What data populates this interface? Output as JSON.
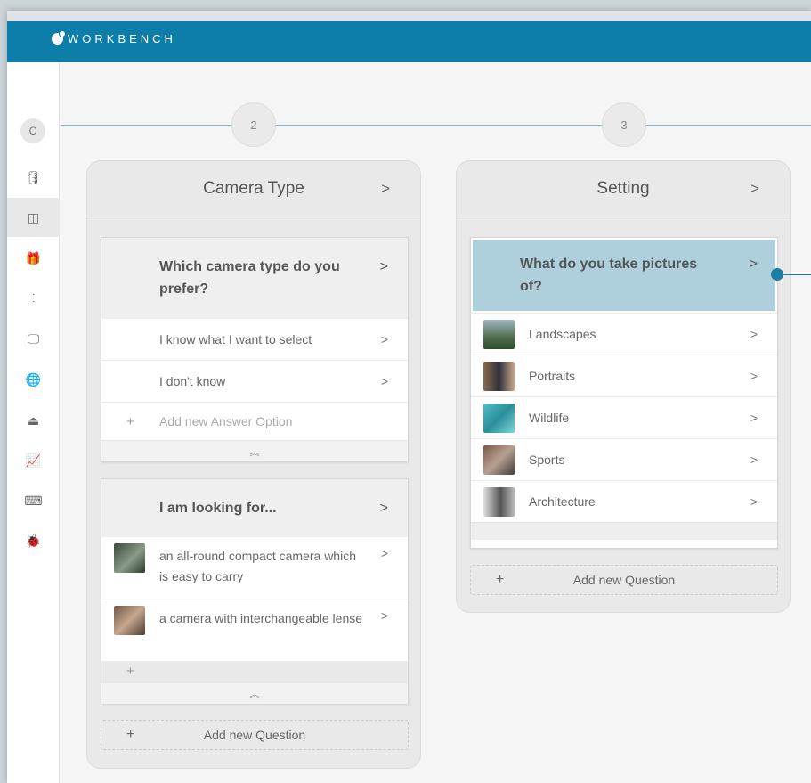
{
  "app": {
    "brand": "WORKBENCH"
  },
  "sidebar": {
    "avatar_letter": "C",
    "items": [
      {
        "icon": "database-icon",
        "glyph": "🛢"
      },
      {
        "icon": "layout-icon",
        "glyph": "◫"
      },
      {
        "icon": "gift-icon",
        "glyph": "🎁"
      },
      {
        "icon": "sliders-icon",
        "glyph": "⫶"
      },
      {
        "icon": "monitor-icon",
        "glyph": "🖵"
      },
      {
        "icon": "globe-icon",
        "glyph": "🌐"
      },
      {
        "icon": "upload-icon",
        "glyph": "⏏"
      },
      {
        "icon": "chart-icon",
        "glyph": "📈"
      },
      {
        "icon": "keyboard-icon",
        "glyph": "⌨"
      },
      {
        "icon": "bug-icon",
        "glyph": "🐞"
      }
    ]
  },
  "steps": {
    "two": "2",
    "three": "3"
  },
  "columns": {
    "camera": {
      "title": "Camera Type",
      "chevron": ">",
      "q1": {
        "title": "Which camera type do you prefer?",
        "answers": [
          "I know what I want to select",
          "I don't know"
        ],
        "add_answer": "Add new Answer Option"
      },
      "q2": {
        "title": "I am looking for...",
        "answers": [
          "an all-round compact camera which is easy to carry",
          "a camera with interchangeable lense"
        ]
      },
      "add_question": "Add new Question"
    },
    "setting": {
      "title": "Setting",
      "chevron": ">",
      "q1": {
        "title": "What do you take pictures of?",
        "answers": [
          "Landscapes",
          "Portraits",
          "Wildlife",
          "Sports",
          "Architecture"
        ]
      },
      "add_question": "Add new Question"
    }
  },
  "glyphs": {
    "chevron": ">",
    "plus": "+",
    "collapse": "≪"
  },
  "colors": {
    "header": "#0d7ea9",
    "selected": "#aed0dc",
    "connector": "#7fbcd3"
  }
}
